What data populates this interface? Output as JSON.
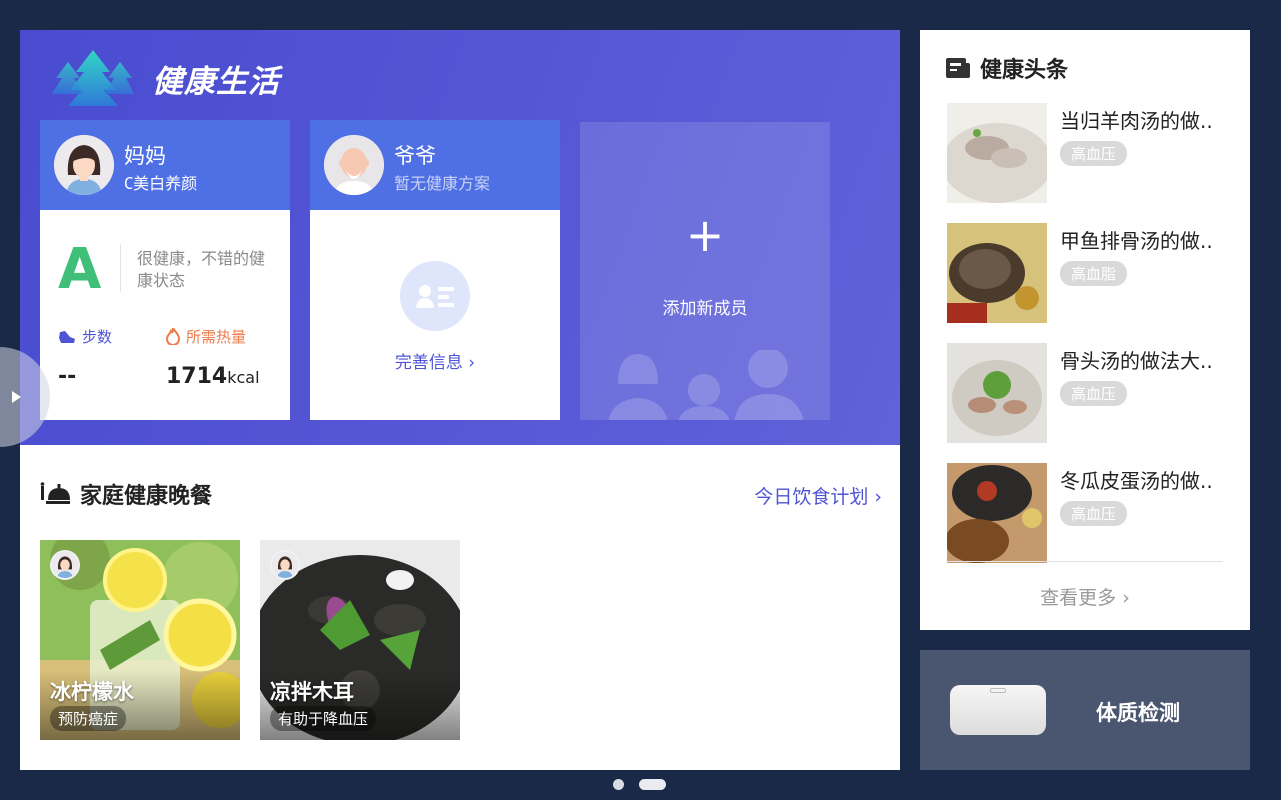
{
  "brand": {
    "title": "健康生活",
    "logo": "tree-logo"
  },
  "members": [
    {
      "name": "妈妈",
      "plan": "美白养颜",
      "plan_icon": "butterfly-icon",
      "grade": "A",
      "grade_desc": "很健康，不错的健康状态",
      "steps_label": "步数",
      "steps_value": "--",
      "calories_label": "所需热量",
      "calories_value": "1714",
      "calories_unit": "kcal"
    },
    {
      "name": "爷爷",
      "plan": "暂无健康方案",
      "action": "完善信息"
    }
  ],
  "add_member": {
    "label": "添加新成员"
  },
  "dinner": {
    "title": "家庭健康晚餐",
    "plan_link": "今日饮食计划",
    "meals": [
      {
        "name": "冰柠檬水",
        "tag": "预防癌症"
      },
      {
        "name": "凉拌木耳",
        "tag": "有助于降血压"
      }
    ]
  },
  "news": {
    "title": "健康头条",
    "items": [
      {
        "title": "当归羊肉汤的做..",
        "tag": "高血压"
      },
      {
        "title": "甲鱼排骨汤的做..",
        "tag": "高血脂"
      },
      {
        "title": "骨头汤的做法大..",
        "tag": "高血压"
      },
      {
        "title": "冬瓜皮蛋汤的做..",
        "tag": "高血压"
      }
    ],
    "more": "查看更多"
  },
  "body_check": {
    "label": "体质检测"
  },
  "colors": {
    "background": "#1b2949",
    "hero": "#4f51d3",
    "card_head": "#4e70e4",
    "accent": "#4f54d4",
    "grade": "#3fbf78",
    "calorie": "#ef7a4a"
  },
  "pager": {
    "pages": 2,
    "current": 2
  }
}
